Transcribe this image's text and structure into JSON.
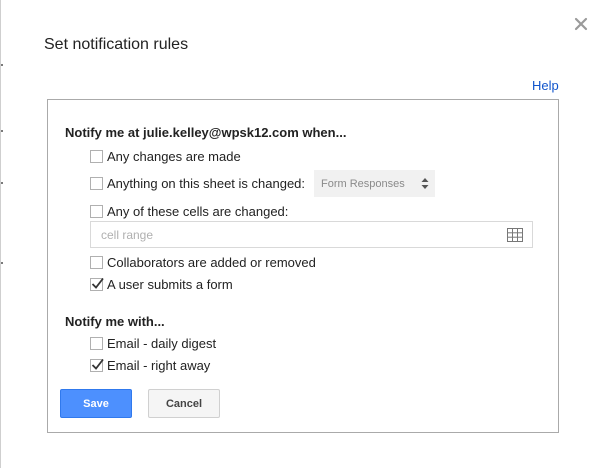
{
  "dialog": {
    "title": "Set notification rules",
    "help_label": "Help"
  },
  "when_section": {
    "heading": "Notify me at julie.kelley@wpsk12.com when...",
    "options": [
      {
        "label": "Any changes are made",
        "checked": false
      },
      {
        "label": "Anything on this sheet is changed:",
        "checked": false
      },
      {
        "label": "Any of these cells are changed:",
        "checked": false
      },
      {
        "label": "Collaborators are added or removed",
        "checked": false
      },
      {
        "label": "A user submits a form",
        "checked": true
      }
    ],
    "sheet_select": {
      "selected": "Form Responses"
    },
    "cell_range": {
      "placeholder": "cell range",
      "value": ""
    }
  },
  "with_section": {
    "heading": "Notify me with...",
    "options": [
      {
        "label": "Email - daily digest",
        "checked": false
      },
      {
        "label": "Email - right away",
        "checked": true
      }
    ]
  },
  "buttons": {
    "save_label": "Save",
    "cancel_label": "Cancel"
  },
  "colors": {
    "accent": "#4d90fe",
    "link": "#1155cc"
  }
}
